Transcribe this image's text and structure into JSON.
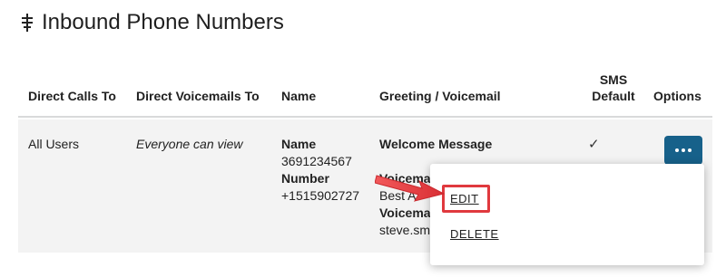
{
  "page": {
    "title": "Inbound Phone Numbers",
    "title_icon": "phone-routing-icon"
  },
  "table": {
    "headers": {
      "direct_calls_to": "Direct Calls To",
      "direct_voicemails_to": "Direct Voicemails To",
      "name": "Name",
      "greeting_voicemail": "Greeting / Voicemail",
      "sms_default_line1": "SMS",
      "sms_default_line2": "Default",
      "options": "Options"
    },
    "rows": [
      {
        "direct_calls_to": "All Users",
        "direct_voicemails_to": "Everyone can view",
        "name_label": "Name",
        "name_value": "3691234567",
        "number_label": "Number",
        "number_value": "+1515902727",
        "greeting_title": "Welcome Message",
        "voicemail_label_partial": "Voicema",
        "voicemail_value_partial": "Best A",
        "voicemail_label_partial_2": "Voicema",
        "email_partial": "steve.sm",
        "sms_default": "✓",
        "options_icon": "more-horizontal-icon"
      }
    ]
  },
  "menu": {
    "items": [
      "EDIT",
      "DELETE"
    ]
  },
  "colors": {
    "options_button": "#17618a",
    "row_background": "#f3f3f3",
    "highlight": "#e0393e"
  }
}
